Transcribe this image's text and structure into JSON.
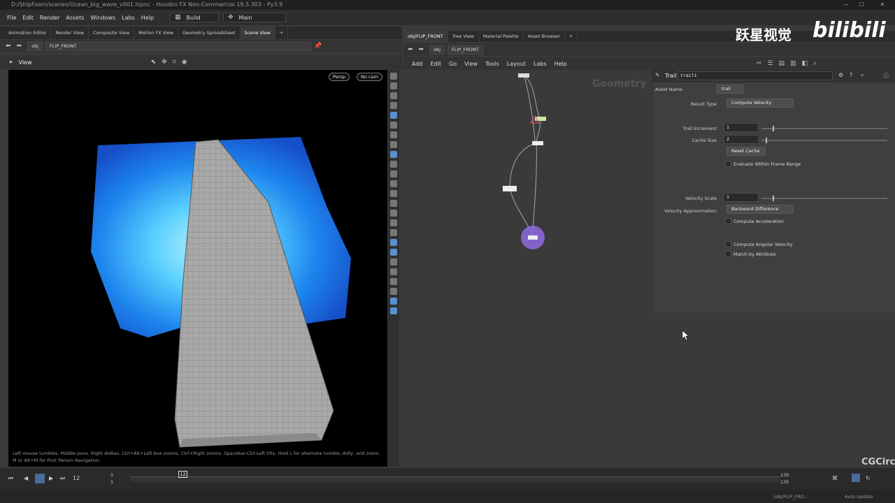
{
  "window": {
    "title": "D:/ShipFoam/scenes/Ocean_big_wave_v001.hipnc - Houdini FX Non-Commercial 19.5.303 - Py3.9"
  },
  "menubar": {
    "items": [
      "File",
      "Edit",
      "Render",
      "Assets",
      "Windows",
      "Labs",
      "Help"
    ],
    "shelf_label": "Build",
    "desktop_label": "Main"
  },
  "left_pane": {
    "tabs": [
      "Animation Editor",
      "Render View",
      "Composite View",
      "Motion FX View",
      "Geometry Spreadsheet",
      "Scene View"
    ],
    "path": [
      "obj",
      "FLIP_FRONT"
    ],
    "view_label": "View",
    "persp_label": "Persp",
    "cam_label": "No cam",
    "help_text": "Left mouse tumbles. Middle pans. Right dollies. Ctrl+Alt+Left box-zooms. Ctrl+Right zooms. Spacebar-Ctrl-Left tilts. Hold L for alternate tumble, dolly, and zoom. M or Alt+M for First Person Navigation."
  },
  "right_pane": {
    "tabs": [
      "obj/FLIP_FRONT",
      "Tree View",
      "Material Palette",
      "Asset Browser"
    ],
    "path": [
      "obj",
      "FLIP_FRONT"
    ],
    "menu": [
      "Add",
      "Edit",
      "Go",
      "View",
      "Tools",
      "Layout",
      "Labs",
      "Help"
    ],
    "network_label": "Geometry"
  },
  "params": {
    "node_type": "Trail",
    "node_name": "trail1",
    "asset_name_label": "Asset Name",
    "asset_name_value": "trail",
    "result_type_label": "Result Type",
    "result_type_value": "Compute Velocity",
    "trail_increment_label": "Trail Increment",
    "trail_increment_value": "1",
    "cache_size_label": "Cache Size",
    "cache_size_value": "2",
    "reset_cache_label": "Reset Cache",
    "eval_frame_range_label": "Evaluate Within Frame Range",
    "velocity_scale_label": "Velocity Scale",
    "velocity_scale_value": "1",
    "velocity_approx_label": "Velocity Approximation",
    "velocity_approx_value": "Backward Difference",
    "compute_accel_label": "Compute Acceleration",
    "compute_angular_label": "Compute Angular Velocity",
    "match_attr_label": "Match by Attribute"
  },
  "timeline": {
    "current_frame": "12",
    "start_frame": "1",
    "end_frame": "135",
    "range_start": "1",
    "range_end": "135"
  },
  "status": {
    "path": "/obj/FLIP_FRO...",
    "auto_update": "Auto Update"
  },
  "watermark": {
    "text": "跃星视觉",
    "logo": "bilibili",
    "corner": "CGCirc"
  }
}
